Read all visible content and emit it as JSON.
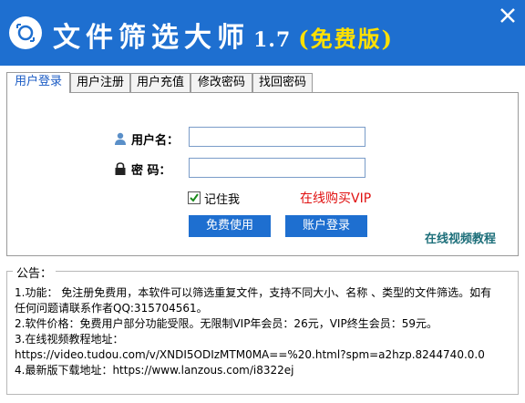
{
  "window": {
    "title": "文件筛选大师",
    "version": "1.7",
    "edition": "(免费版)"
  },
  "tabs": [
    {
      "label": "用户登录",
      "active": true
    },
    {
      "label": "用户注册",
      "active": false
    },
    {
      "label": "用户充值",
      "active": false
    },
    {
      "label": "修改密码",
      "active": false
    },
    {
      "label": "找回密码",
      "active": false
    }
  ],
  "login": {
    "username_label": "用户名：",
    "password_label": "密 码：",
    "username_value": "",
    "password_value": "",
    "remember_label": "记住我",
    "remember_checked": true,
    "buy_vip_link": "在线购买VIP",
    "free_use_button": "免费使用",
    "account_login_button": "账户登录",
    "video_tutorial_link": "在线视频教程"
  },
  "notice": {
    "title": "公告：",
    "lines": [
      "1.功能： 免注册免费用，本软件可以筛选重复文件，支持不同大小、名称 、类型的文件筛选。如有",
      "任何问题请联系作者QQ:315704561。",
      "2.软件价格：免费用户部分功能受限。无限制VIP年会员：26元，VIP终生会员：59元。",
      "3.在线视频教程地址：",
      "https://video.tudou.com/v/XNDI5ODIzMTM0MA==%20.html?spm=a2hzp.8244740.0.0",
      "4.最新版下载地址：https://www.lanzous.com/i8322ej"
    ]
  },
  "colors": {
    "titlebar": "#1e6fd0",
    "edition": "#ffe000",
    "buy_link": "#e01010",
    "video_link": "#1d6f7a",
    "active_tab_text": "#1a5bc4"
  },
  "icons": [
    "magnifier-logo-icon",
    "close-icon",
    "user-icon",
    "lock-icon",
    "checkbox-checked-icon"
  ]
}
